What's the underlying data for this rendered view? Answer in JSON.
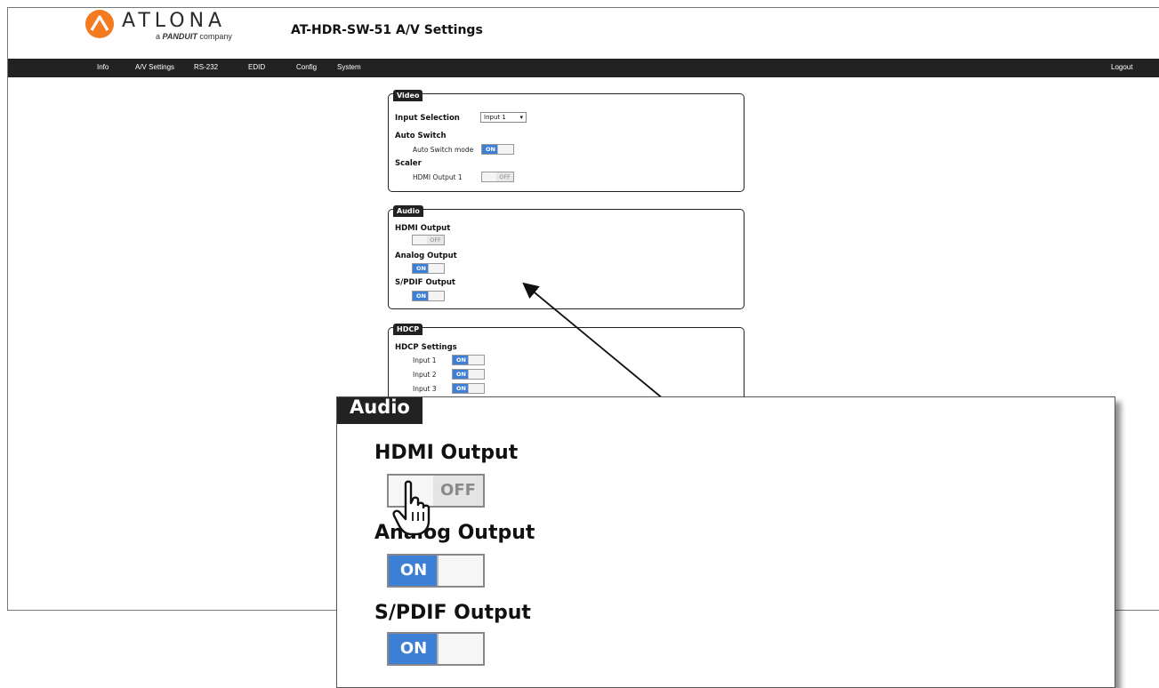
{
  "header": {
    "logo_text": "ATLONA",
    "logo_sub_prefix": "a",
    "logo_sub_brand": "PANDUIT",
    "logo_sub_suffix": "company",
    "device_title": "AT-HDR-SW-51   A/V Settings"
  },
  "nav": {
    "items": [
      "Info",
      "A/V Settings",
      "RS-232",
      "EDID",
      "Config",
      "System"
    ],
    "logout": "Logout"
  },
  "video": {
    "title": "Video",
    "input_selection_label": "Input Selection",
    "input_selection_value": "Input 1",
    "auto_switch_label": "Auto Switch",
    "auto_switch_mode_label": "Auto Switch mode",
    "auto_switch_mode_state": "ON",
    "scaler_label": "Scaler",
    "hdmi_output1_label": "HDMI Output 1",
    "hdmi_output1_state": "OFF"
  },
  "audio": {
    "title": "Audio",
    "hdmi_output_label": "HDMI Output",
    "hdmi_output_state": "OFF",
    "analog_output_label": "Analog Output",
    "analog_output_state": "ON",
    "spdif_output_label": "S/PDIF Output",
    "spdif_output_state": "ON"
  },
  "hdcp": {
    "title": "HDCP",
    "settings_label": "HDCP Settings",
    "inputs": [
      {
        "label": "Input 1",
        "state": "ON"
      },
      {
        "label": "Input 2",
        "state": "ON"
      },
      {
        "label": "Input 3",
        "state": "ON"
      }
    ]
  },
  "zoom": {
    "title": "Audio",
    "hdmi_output_label": "HDMI Output",
    "hdmi_output_state": "OFF",
    "analog_output_label": "Analog Output",
    "analog_output_state": "ON",
    "spdif_output_label": "S/PDIF Output",
    "spdif_output_state": "ON"
  },
  "colors": {
    "nav_bg": "#222222",
    "toggle_on": "#3c7fd5",
    "logo_orange": "#f47b20"
  }
}
